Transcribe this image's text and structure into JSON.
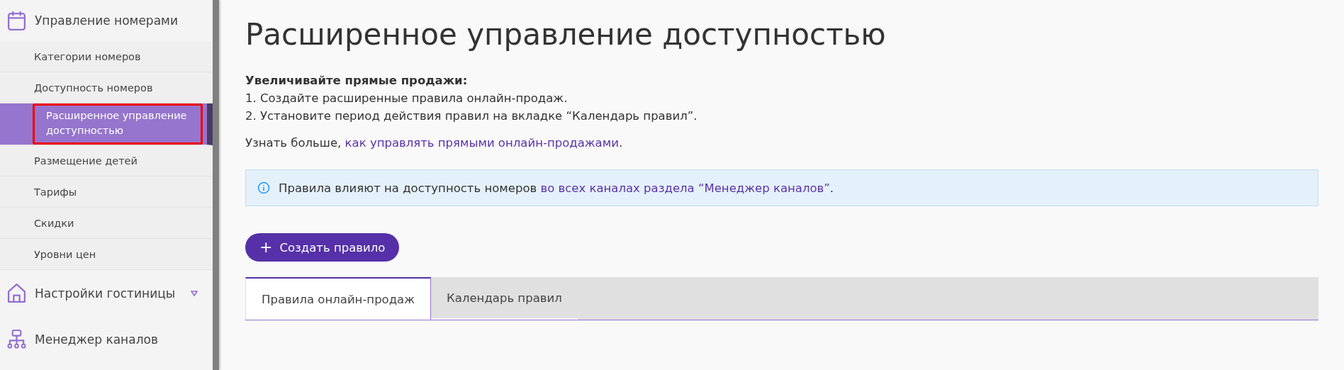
{
  "sidebar": {
    "sections": [
      {
        "label": "Управление номерами",
        "kind": "group",
        "expanded": true,
        "items": [
          {
            "label": "Категории номеров",
            "selected": false,
            "highlighted": false
          },
          {
            "label": "Доступность номеров",
            "selected": false,
            "highlighted": false
          },
          {
            "label": "Расширенное управление доступностью",
            "selected": true,
            "highlighted": true
          },
          {
            "label": "Размещение детей",
            "selected": false,
            "highlighted": false
          },
          {
            "label": "Тарифы",
            "selected": false,
            "highlighted": false
          },
          {
            "label": "Скидки",
            "selected": false,
            "highlighted": false
          },
          {
            "label": "Уровни цен",
            "selected": false,
            "highlighted": false
          }
        ]
      },
      {
        "label": "Настройки гостиницы",
        "kind": "group",
        "expanded": false
      },
      {
        "label": "Менеджер каналов",
        "kind": "link"
      }
    ]
  },
  "page": {
    "title": "Расширенное управление доступностью",
    "intro_heading": "Увеличивайте прямые продажи:",
    "steps": [
      "1. Создайте расширенные правила онлайн-продаж.",
      "2. Установите период действия правил на вкладке “Календарь правил”."
    ],
    "learn_more": {
      "text": "Узнать больше, ",
      "link": "как управлять прямыми онлайн-продажами",
      "after": "."
    },
    "info": {
      "text": "Правила влияют на доступность номеров ",
      "link": "во всех каналах раздела “Менеджер каналов”",
      "after": "."
    },
    "create_button": {
      "icon": "+",
      "label": "Создать правило"
    },
    "tabs": [
      {
        "label": "Правила онлайн-продаж",
        "selected": true
      },
      {
        "label": "Календарь правил",
        "selected": false
      }
    ]
  }
}
